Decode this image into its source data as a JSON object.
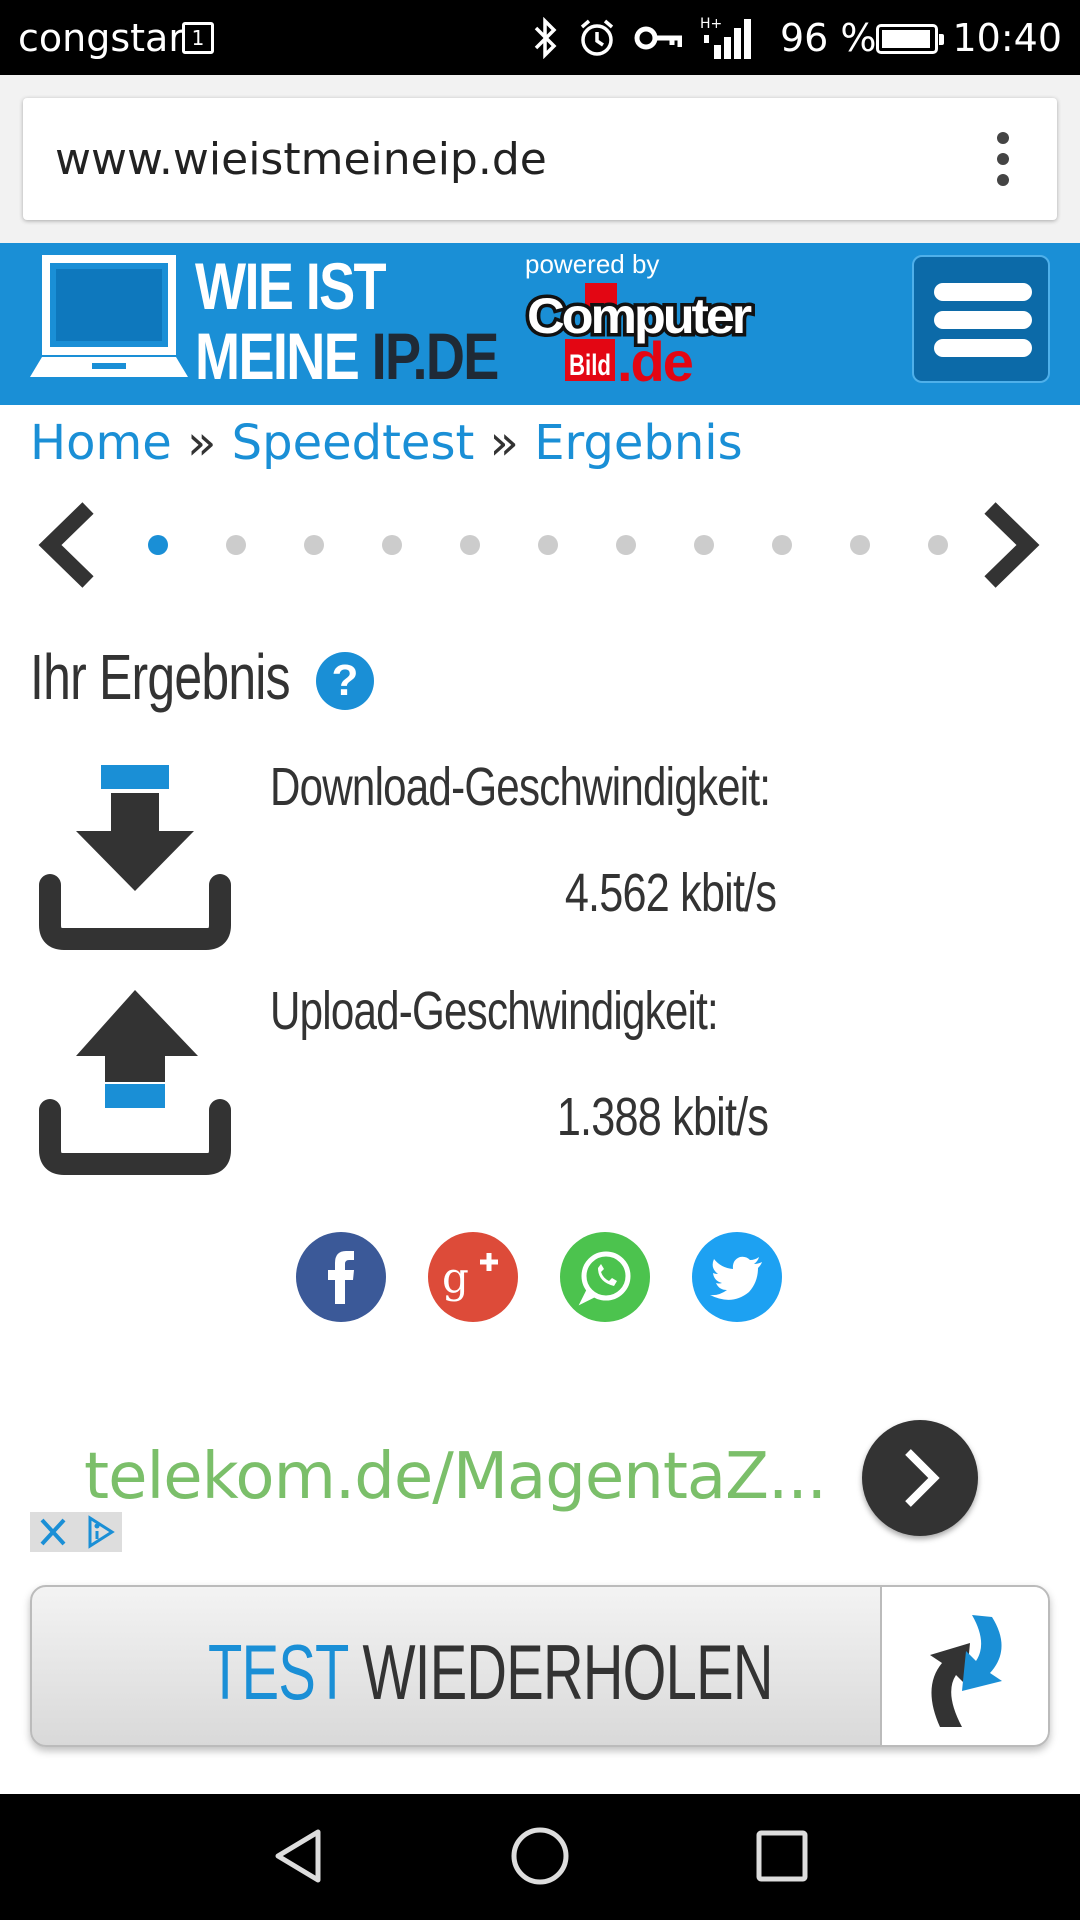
{
  "status_bar": {
    "carrier": "congstar",
    "sim_slot": "1",
    "network_type": "H+",
    "battery_percent": "96 %",
    "battery_level": 0.96,
    "time": "10:40",
    "icons": [
      "bluetooth-icon",
      "alarm-icon",
      "vpn-key-icon",
      "signal-icon"
    ]
  },
  "browser": {
    "url": "www.wieistmeineip.de"
  },
  "header": {
    "logo_line1": "WIE IST",
    "logo_line2_light": "MEINE ",
    "logo_line2_dark": "IP.DE",
    "powered_by": "powered by",
    "partner_logo_text": "Computer Bild .de"
  },
  "breadcrumb": {
    "home": "Home",
    "sep1": " » ",
    "speedtest": "Speedtest",
    "sep2": " » ",
    "current": "Ergebnis"
  },
  "carousel": {
    "page_count": 11,
    "active_index": 0
  },
  "result": {
    "title": "Ihr Ergebnis",
    "help": "?",
    "download_label": "Download-Geschwindigkeit:",
    "download_value": "4.562 kbit/s",
    "upload_label": "Upload-Geschwindigkeit:",
    "upload_value": "1.388 kbit/s"
  },
  "social": [
    {
      "name": "facebook",
      "color": "#3b5998"
    },
    {
      "name": "google-plus",
      "color": "#dd4b39"
    },
    {
      "name": "whatsapp",
      "color": "#4cc34e"
    },
    {
      "name": "twitter",
      "color": "#1da1f2"
    }
  ],
  "ad": {
    "text": "telekom.de/MagentaZ..."
  },
  "retest": {
    "label_blue": "TEST",
    "label_dark": " WIEDERHOLEN"
  },
  "colors": {
    "brand_blue": "#1a8fd6",
    "text_dark": "#333333",
    "ad_green": "#7bbf6a"
  }
}
